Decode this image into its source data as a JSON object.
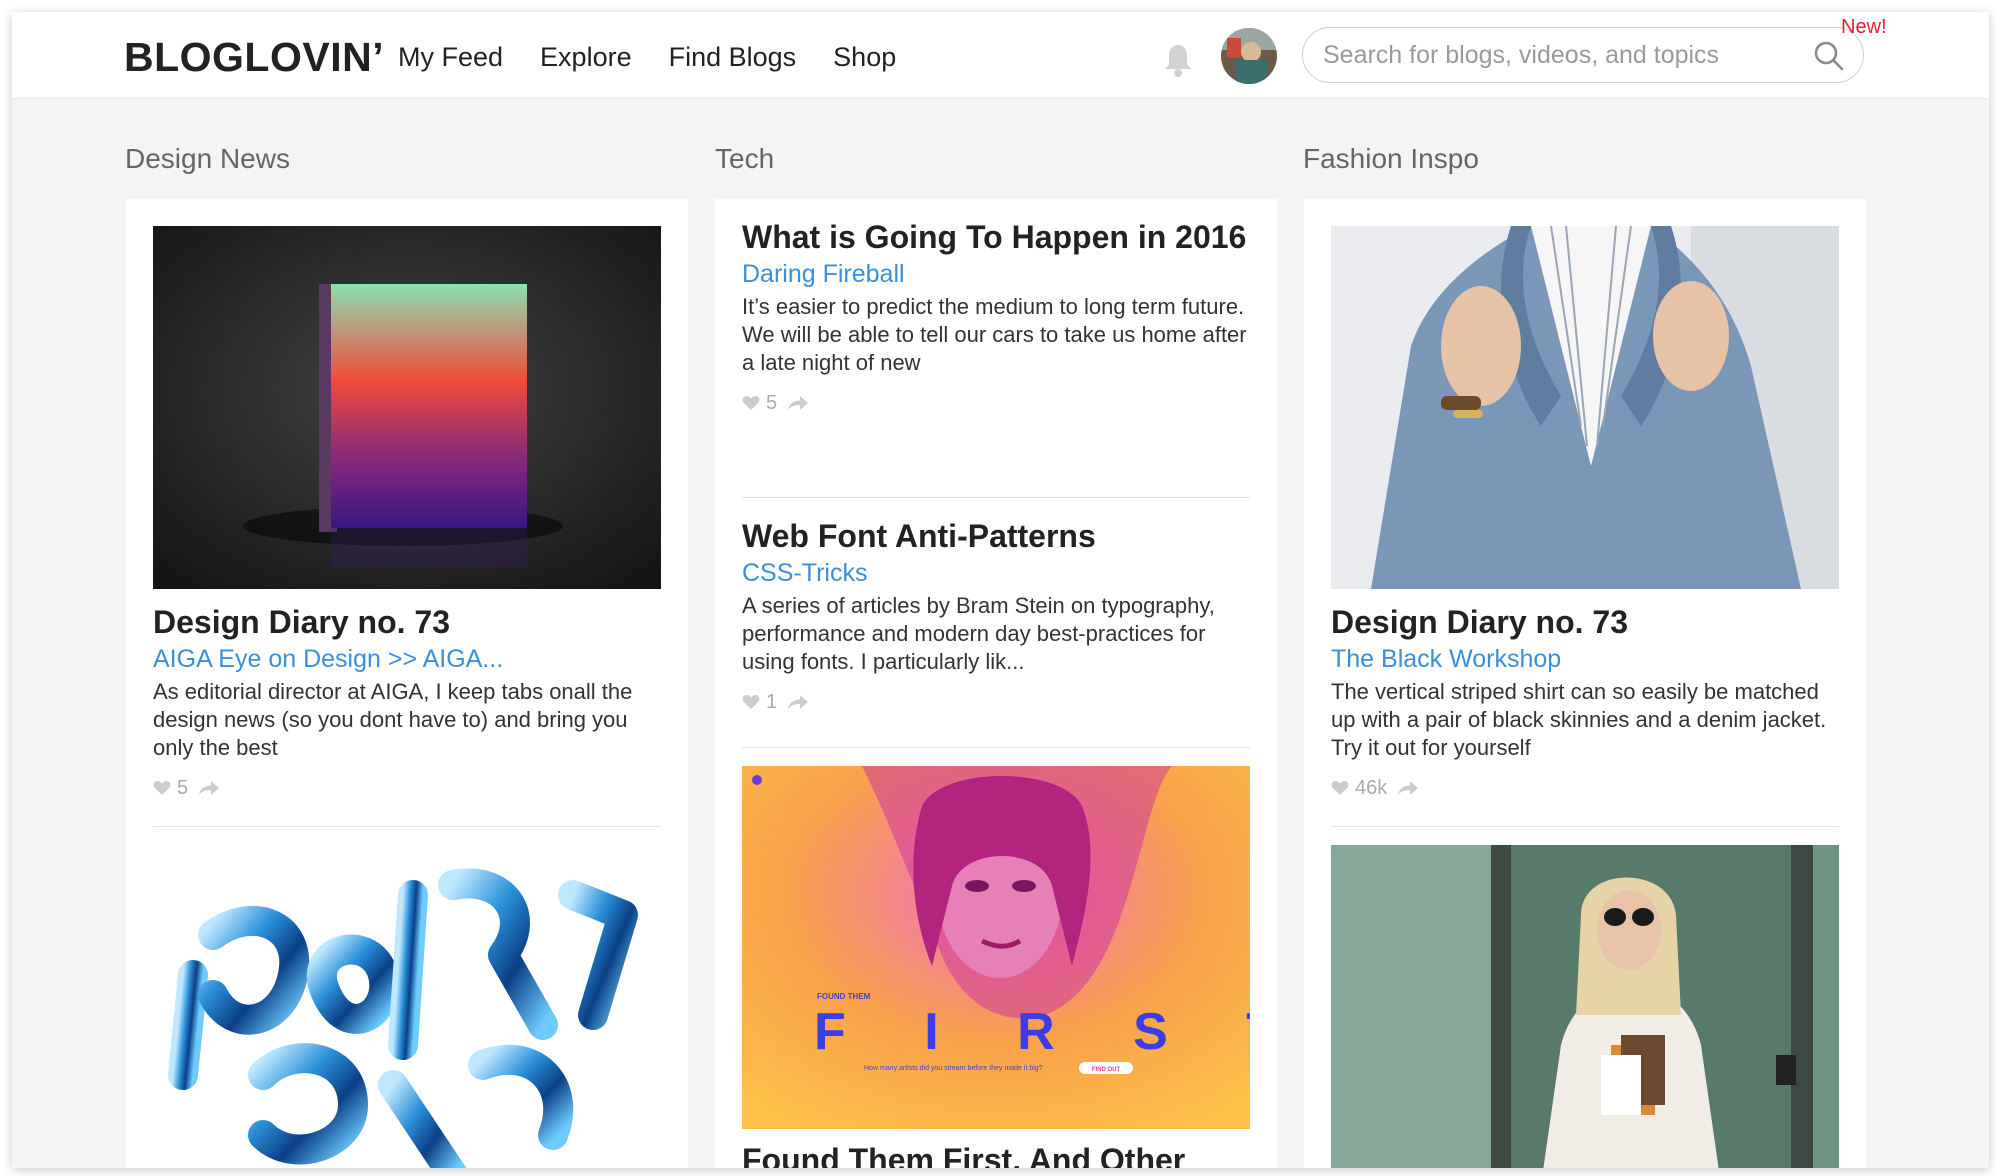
{
  "header": {
    "logo": "BLOGLOVIN’",
    "nav": [
      "My Feed",
      "Explore",
      "Find Blogs",
      "Shop"
    ],
    "search_placeholder": "Search for blogs, videos, and topics",
    "new_badge": "New!"
  },
  "columns": [
    {
      "title": "Design News",
      "posts": [
        {
          "title": "Design Diary no. 73",
          "source": "AIGA Eye on Design >> AIGA...",
          "excerpt": "As editorial director at AIGA, I keep tabs onall the design news (so you dont have to) and bring you only the best",
          "likes": "5",
          "image": "gradient-book-image"
        },
        {
          "image": "blue-chrome-letters-image"
        }
      ]
    },
    {
      "title": "Tech",
      "posts": [
        {
          "title": "What is Going To Happen in 2016",
          "source": "Daring Fireball",
          "excerpt": "It’s easier to predict the medium to long term future. We will be able to tell our cars to take us home after a late night of new",
          "likes": "5"
        },
        {
          "title": "Web Font Anti-Patterns",
          "source": "CSS-Tricks",
          "excerpt": "A series of articles by Bram Stein on typography, performance and modern day best-practices for using fonts. I particularly lik...",
          "likes": "1"
        },
        {
          "title": "Found Them First, And Other",
          "image": "found-them-first-image",
          "image_text": {
            "small_label": "FOUND THEM",
            "big_word": "F I R S T",
            "caption": "How many artists did you stream before they made it big?",
            "button": "FIND OUT"
          }
        }
      ]
    },
    {
      "title": "Fashion Inspo",
      "posts": [
        {
          "title": "Design Diary no. 73",
          "source": "The Black Workshop",
          "excerpt": "The vertical striped shirt can so easily be matched up with a pair of black skinnies and a denim jacket. Try it out for yourself",
          "likes": "46k",
          "image": "denim-jacket-image"
        },
        {
          "image": "street-style-image"
        }
      ]
    }
  ],
  "colors": {
    "link": "#3b8fd9",
    "badge": "#e0242a",
    "background": "#f4f4f4"
  }
}
